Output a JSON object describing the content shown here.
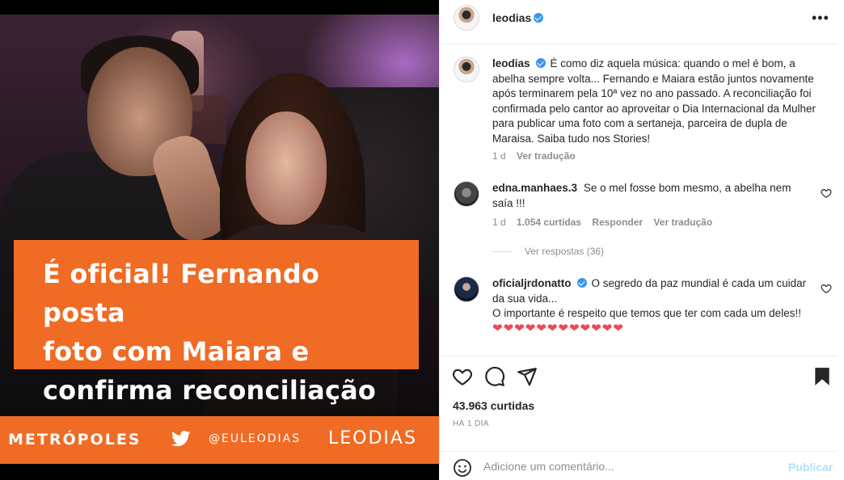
{
  "image": {
    "headline_lines": [
      "É oficial! Fernando posta",
      "foto com Maiara e",
      "confirma reconciliação"
    ],
    "brand_logo": "METRÓPOLES",
    "brand_handle": "@EULEODIAS",
    "brand_name": "LEODIAS"
  },
  "header": {
    "username": "leodias",
    "more": "•••"
  },
  "caption": {
    "username": "leodias",
    "text": "É como diz aquela música: quando o mel é bom, a abelha sempre volta... Fernando e Maiara estão juntos novamente após terminarem pela 10ª vez no ano passado. A reconciliação foi confirmada pelo cantor ao aproveitar o Dia Internacional da Mulher para publicar uma foto com a sertaneja, parceira de dupla de Maraisa. Saiba tudo nos Stories!",
    "time": "1 d",
    "see_translation": "Ver tradução"
  },
  "comments": [
    {
      "username": "edna.manhaes.3",
      "text": "Se o mel fosse bom mesmo, a abelha nem saía !!!",
      "time": "1 d",
      "likes": "1.054 curtidas",
      "reply": "Responder",
      "see_translation": "Ver tradução",
      "view_replies": "Ver respostas (36)"
    },
    {
      "username": "oficialjrdonatto",
      "line1": "O segredo da paz mundial é cada um cuidar da sua vida...",
      "line2": "O importante é respeito que temos que ter com cada um deles!!",
      "hearts": "❤❤❤❤❤❤❤❤❤❤❤❤"
    }
  ],
  "post": {
    "likes": "43.963 curtidas",
    "time_ago": "HÁ 1 DIA"
  },
  "add_comment": {
    "placeholder": "Adicione um comentário...",
    "publish": "Publicar"
  },
  "colors": {
    "accent_orange": "#f06b24",
    "verified_blue": "#3897f0",
    "heart_red": "#ed4956",
    "publish_disabled": "#b2dffc"
  },
  "icons": [
    "more-options-icon",
    "verified-icon",
    "heart-icon",
    "comment-icon",
    "share-icon",
    "bookmark-icon",
    "emoji-icon",
    "twitter-icon"
  ]
}
